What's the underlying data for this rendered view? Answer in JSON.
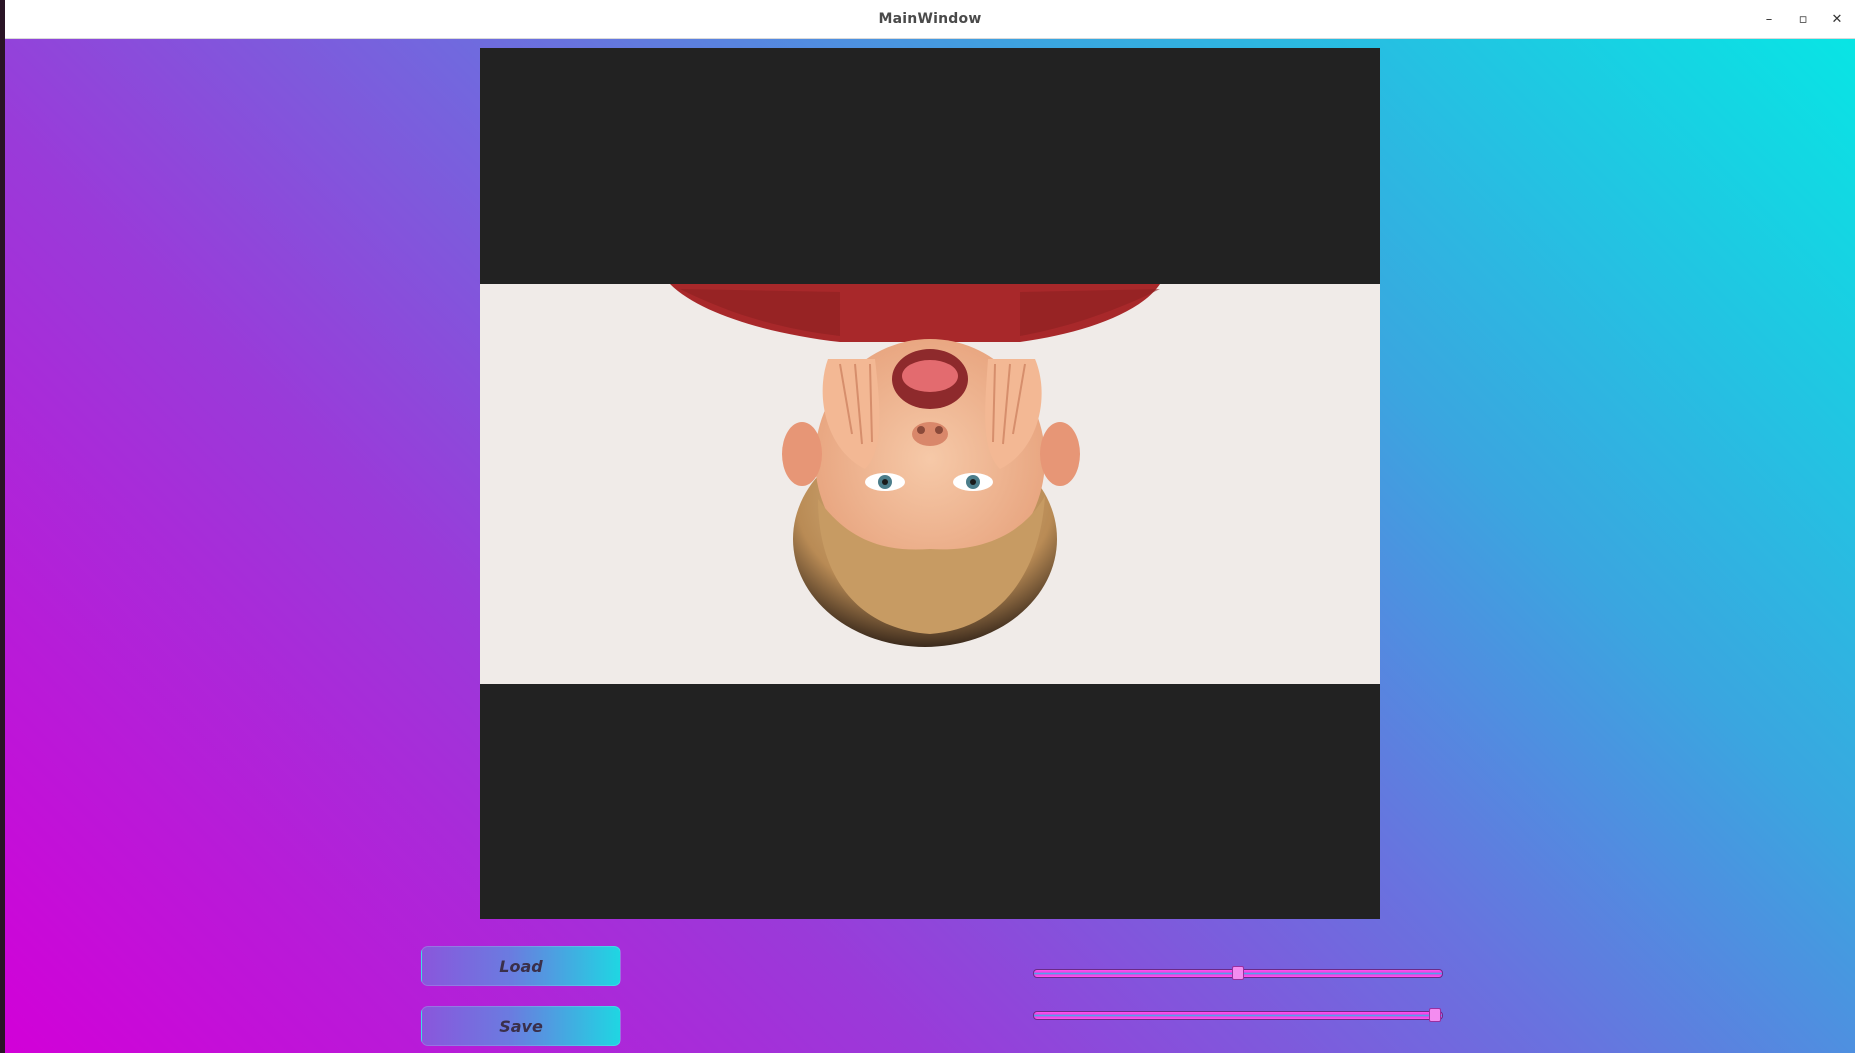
{
  "window": {
    "title": "MainWindow",
    "minimize_glyph": "–",
    "maximize_glyph": "▫",
    "close_glyph": "✕"
  },
  "image_view": {
    "background": "#222222",
    "photo_background": "#f0ebe8",
    "orientation": "upside-down"
  },
  "buttons": {
    "load_label": "Load",
    "save_label": "Save"
  },
  "sliders": [
    {
      "name": "slider-1",
      "value_fraction": 0.5
    },
    {
      "name": "slider-2",
      "value_fraction": 0.99
    }
  ],
  "colors": {
    "gradient_start": "#d200d8",
    "gradient_end": "#08e5e4",
    "slider_track": "#f040e6",
    "slider_handle": "#f38cf0"
  }
}
